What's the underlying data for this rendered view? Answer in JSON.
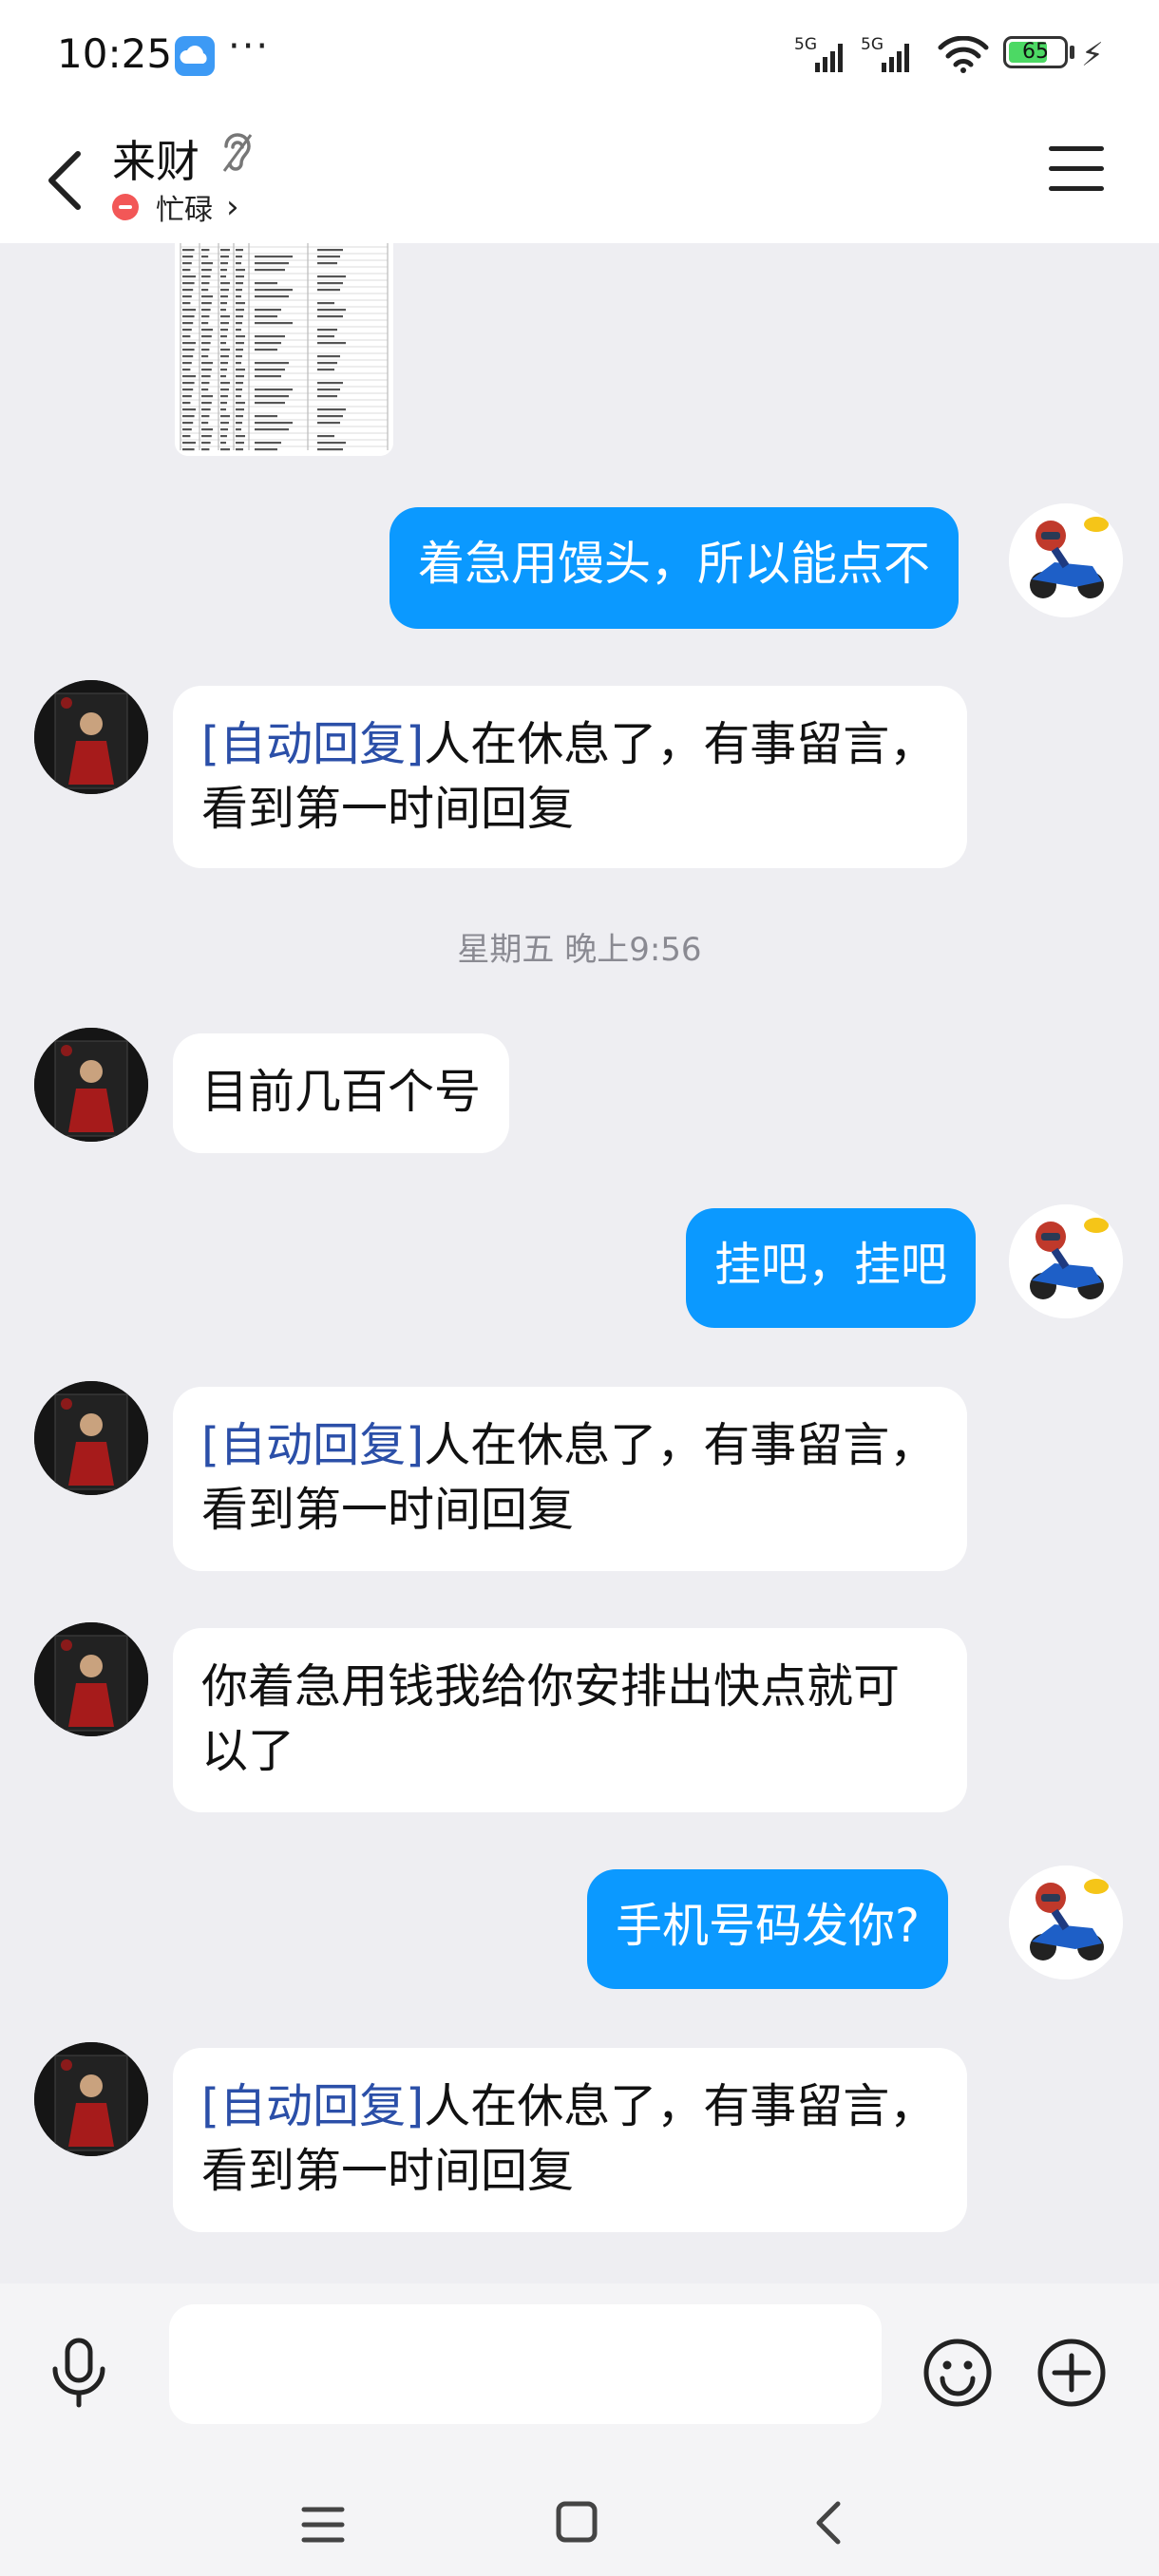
{
  "status_bar": {
    "time": "10:25",
    "more": "···",
    "signal1": "5G",
    "signal2": "5G",
    "battery": "65"
  },
  "header": {
    "title": "来财",
    "status": "忙碌",
    "status_chevron": "›"
  },
  "messages": [
    {
      "side": "out",
      "text": "着急用馒头，所以能点不"
    },
    {
      "side": "in",
      "auto_tag": "[自动回复]",
      "text": "人在休息了，有事留言，看到第一时间回复"
    },
    {
      "side": "divider",
      "text": "星期五 晚上9:56"
    },
    {
      "side": "in",
      "text": "目前几百个号"
    },
    {
      "side": "out",
      "text": "挂吧，挂吧"
    },
    {
      "side": "in",
      "auto_tag": "[自动回复]",
      "text": "人在休息了，有事留言，看到第一时间回复"
    },
    {
      "side": "in",
      "text": "你着急用钱我给你安排出快点就可以了"
    },
    {
      "side": "out",
      "text": "手机号码发你?"
    },
    {
      "side": "in",
      "auto_tag": "[自动回复]",
      "text": "人在休息了，有事留言，看到第一时间回复"
    }
  ],
  "input": {
    "value": "",
    "placeholder": ""
  },
  "icons": {
    "back": "chevron-left-icon",
    "ear": "ear-icon",
    "menu": "hamburger-menu-icon",
    "mic": "microphone-icon",
    "emoji": "smiley-icon",
    "plus": "plus-circle-icon",
    "nav_menu": "nav-menu-icon",
    "nav_home": "nav-home-icon",
    "nav_back": "nav-back-icon"
  },
  "colors": {
    "outgoing_bubble": "#0b99ff",
    "auto_reply_tag": "#2b4fa8",
    "busy": "#f25757",
    "background": "#eeeef2"
  }
}
